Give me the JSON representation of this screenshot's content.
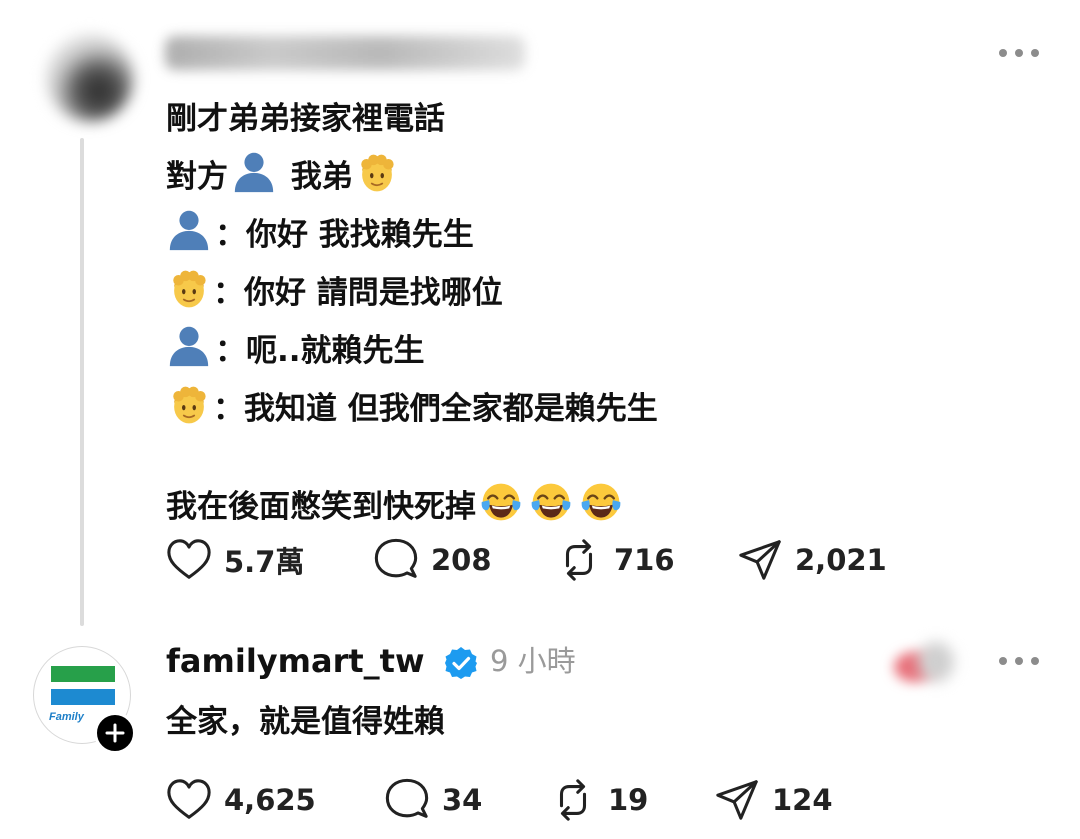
{
  "post": {
    "lines": [
      "剛才弟弟接家裡電話",
      "對方",
      "我弟",
      "：你好 我找賴先生",
      "：你好 請問是找哪位",
      "：呃..就賴先生",
      "：我知道 但我們全家都是賴先生",
      "我在後面憋笑到快死掉"
    ],
    "icons": {
      "caller": "person-silhouette-emoji",
      "brother": "blond-person-emoji",
      "laugh": "tears-of-joy-emoji"
    },
    "actions": {
      "likes": "5.7萬",
      "comments": "208",
      "reposts": "716",
      "shares": "2,021"
    }
  },
  "reply": {
    "username": "familymart_tw",
    "time": "9 小時",
    "avatar_text": "Family",
    "text": "全家，就是值得姓賴",
    "actions": {
      "likes": "4,625",
      "comments": "34",
      "reposts": "19",
      "shares": "124"
    }
  },
  "colors": {
    "text": "#111111",
    "muted": "#9a9a9a",
    "verified": "#1d9bf0",
    "fm_green": "#27a04a",
    "fm_blue": "#1d8ad1"
  }
}
